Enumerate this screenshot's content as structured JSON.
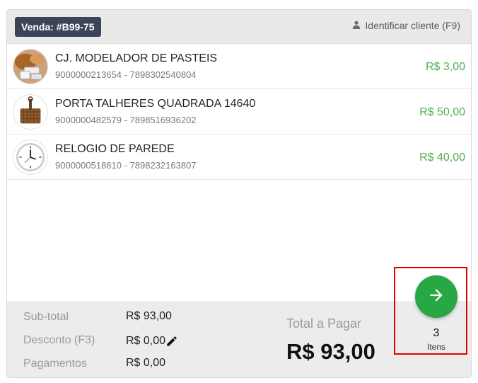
{
  "header": {
    "sale_badge": "Venda: #B99-75",
    "identify_client": "Identificar cliente (F9)"
  },
  "items": [
    {
      "name": "CJ. MODELADOR DE PASTEIS",
      "codes": "9000000213654 - 7898302540804",
      "price": "R$ 3,00",
      "thumb": "pastry-mold-image"
    },
    {
      "name": "PORTA TALHERES QUADRADA 14640",
      "codes": "9000000482579 - 7898516936202",
      "price": "R$ 50,00",
      "thumb": "cutlery-holder-image"
    },
    {
      "name": "RELOGIO DE PAREDE",
      "codes": "9000000518810 - 7898232163807",
      "price": "R$ 40,00",
      "thumb": "wall-clock-image"
    }
  ],
  "summary": {
    "subtotal_label": "Sub-total",
    "subtotal_value": "R$ 93,00",
    "discount_label": "Desconto (F3)",
    "discount_value": "R$ 0,00",
    "payments_label": "Pagamentos",
    "payments_value": "R$ 0,00",
    "total_label": "Total a Pagar",
    "total_value": "R$ 93,00"
  },
  "checkout": {
    "item_count": "3",
    "item_count_label": "Itens"
  },
  "colors": {
    "badge_bg": "#3c4458",
    "price_green": "#4caf50",
    "next_button": "#28a745",
    "highlight_border": "#e00000"
  }
}
